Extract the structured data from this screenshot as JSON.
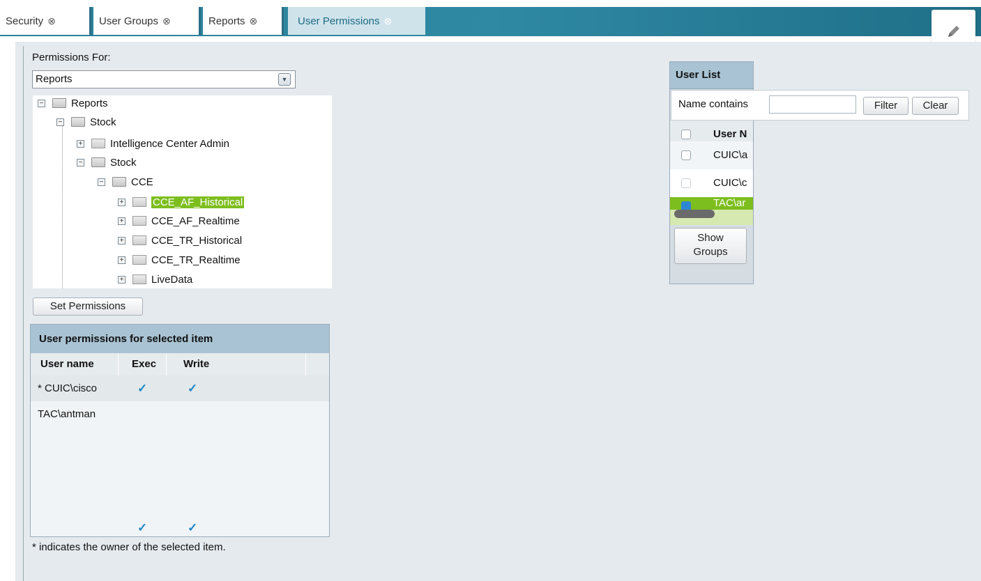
{
  "tabs": [
    {
      "label": "Security",
      "close": "⊗"
    },
    {
      "label": "User Groups",
      "close": "⊗"
    },
    {
      "label": "Reports",
      "close": "⊗"
    },
    {
      "label": "User Permissions",
      "close": "⊗"
    }
  ],
  "edit_icon": "pencil-icon",
  "permissions_for": {
    "label": "Permissions For:",
    "selected": "Reports"
  },
  "tree": {
    "root": "Reports",
    "stock1": "Stock",
    "ica": "Intelligence Center Admin",
    "stock2": "Stock",
    "cce": "CCE",
    "items": [
      "CCE_AF_Historical",
      "CCE_AF_Realtime",
      "CCE_TR_Historical",
      "CCE_TR_Realtime",
      "LiveData"
    ],
    "selected": "CCE_AF_Historical",
    "toggle_expanded": "−",
    "toggle_collapsed": "+"
  },
  "set_permissions_label": "Set Permissions",
  "perm_table": {
    "title": "User permissions for selected item",
    "columns": [
      "User name",
      "Exec",
      "Write"
    ],
    "rows": [
      {
        "user": "* CUIC\\cisco",
        "exec": "✓",
        "write": "✓"
      },
      {
        "user": "TAC\\antman",
        "exec": "✓",
        "write": "✓"
      }
    ]
  },
  "owner_note": "* indicates the owner of the selected item.",
  "user_list": {
    "title": "User List",
    "filter_label": "Name contains",
    "filter_value": "",
    "filter_button": "Filter",
    "clear_button": "Clear",
    "column": "User N",
    "rows": [
      "CUIC\\a",
      "CUIC\\c",
      "TAC\\ar"
    ],
    "show_groups_line1": "Show",
    "show_groups_line2": "Groups"
  },
  "colors": {
    "tab_strip": "#2a7f98",
    "highlight": "#7dbe1f",
    "check": "#1f87c8",
    "header": "#a9c3d4"
  }
}
